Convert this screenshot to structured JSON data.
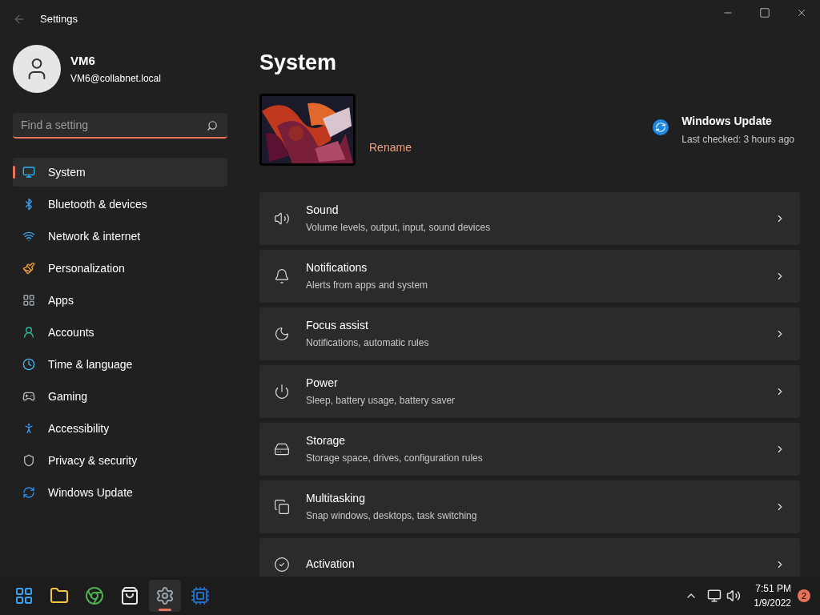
{
  "window": {
    "title": "Settings"
  },
  "profile": {
    "name": "VM6",
    "email": "VM6@collabnet.local"
  },
  "search": {
    "placeholder": "Find a setting"
  },
  "sidebar": {
    "items": [
      {
        "label": "System",
        "kind": "system",
        "selected": true
      },
      {
        "label": "Bluetooth & devices",
        "kind": "bluetooth",
        "selected": false
      },
      {
        "label": "Network & internet",
        "kind": "network",
        "selected": false
      },
      {
        "label": "Personalization",
        "kind": "brush",
        "selected": false
      },
      {
        "label": "Apps",
        "kind": "apps",
        "selected": false
      },
      {
        "label": "Accounts",
        "kind": "accounts",
        "selected": false
      },
      {
        "label": "Time & language",
        "kind": "time",
        "selected": false
      },
      {
        "label": "Gaming",
        "kind": "gaming",
        "selected": false
      },
      {
        "label": "Accessibility",
        "kind": "accessibility",
        "selected": false
      },
      {
        "label": "Privacy & security",
        "kind": "privacy",
        "selected": false
      },
      {
        "label": "Windows Update",
        "kind": "update",
        "selected": false
      }
    ]
  },
  "page": {
    "title": "System",
    "rename": "Rename",
    "update": {
      "title": "Windows Update",
      "subtitle": "Last checked: 3 hours ago"
    },
    "cards": [
      {
        "kind": "sound",
        "title": "Sound",
        "description": "Volume levels, output, input, sound devices"
      },
      {
        "kind": "notifications",
        "title": "Notifications",
        "description": "Alerts from apps and system"
      },
      {
        "kind": "focus",
        "title": "Focus assist",
        "description": "Notifications, automatic rules"
      },
      {
        "kind": "power",
        "title": "Power",
        "description": "Sleep, battery usage, battery saver"
      },
      {
        "kind": "storage",
        "title": "Storage",
        "description": "Storage space, drives, configuration rules"
      },
      {
        "kind": "multitasking",
        "title": "Multitasking",
        "description": "Snap windows, desktops, task switching"
      },
      {
        "kind": "activation",
        "title": "Activation"
      }
    ]
  },
  "taskbar": {
    "apps": [
      {
        "kind": "start",
        "selected": false
      },
      {
        "kind": "explorer",
        "selected": false
      },
      {
        "kind": "browser",
        "selected": false
      },
      {
        "kind": "store",
        "selected": false
      },
      {
        "kind": "settings",
        "selected": true
      },
      {
        "kind": "chip",
        "selected": false
      }
    ],
    "time": "7:51 PM",
    "date": "1/9/2022",
    "badge": "2"
  }
}
